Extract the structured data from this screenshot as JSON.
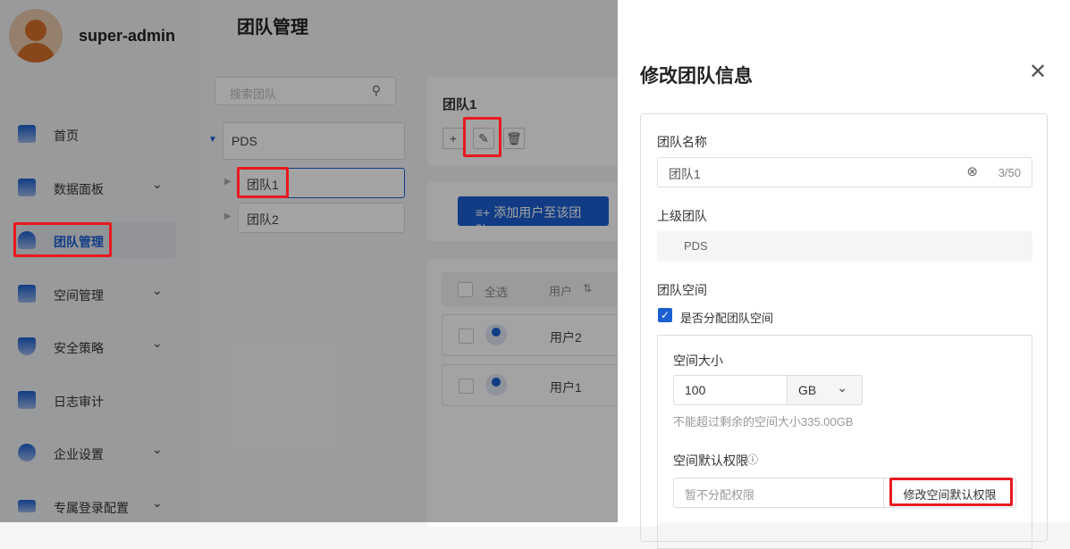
{
  "user": {
    "name": "super-admin"
  },
  "page_title": "团队管理",
  "sidebar": {
    "items": [
      {
        "label": "首页",
        "icon": "home-icon",
        "chevron": false
      },
      {
        "label": "数据面板",
        "icon": "dashboard-icon",
        "chevron": true
      },
      {
        "label": "团队管理",
        "icon": "user-icon",
        "chevron": false,
        "active": true
      },
      {
        "label": "空间管理",
        "icon": "storage-icon",
        "chevron": true
      },
      {
        "label": "安全策略",
        "icon": "shield-icon",
        "chevron": true
      },
      {
        "label": "日志审计",
        "icon": "log-icon",
        "chevron": false
      },
      {
        "label": "企业设置",
        "icon": "gear-icon",
        "chevron": true
      },
      {
        "label": "专属登录配置",
        "icon": "sliders-icon",
        "chevron": true
      }
    ]
  },
  "tree": {
    "search_placeholder": "搜索团队",
    "root": "PDS",
    "children": [
      "团队1",
      "团队2"
    ]
  },
  "team": {
    "name": "团队1",
    "add_user_label": "添加用户至该团队",
    "table": {
      "select_all": "全选",
      "col_user": "用户",
      "rows": [
        "用户2",
        "用户1"
      ]
    }
  },
  "drawer": {
    "title": "修改团队信息",
    "name_label": "团队名称",
    "name_value": "团队1",
    "name_count": "3/50",
    "parent_label": "上级团队",
    "parent_value": "PDS",
    "space_label": "团队空间",
    "allocate_label": "是否分配团队空间",
    "allocate_checked": true,
    "size_label": "空间大小",
    "size_value": "100",
    "unit": "GB",
    "size_hint": "不能超过剩余的空间大小335.00GB",
    "perm_label": "空间默认权限",
    "perm_placeholder": "暂不分配权限",
    "perm_button": "修改空间默认权限"
  },
  "colors": {
    "accent": "#1b5fd0",
    "highlight": "#e8191f"
  }
}
